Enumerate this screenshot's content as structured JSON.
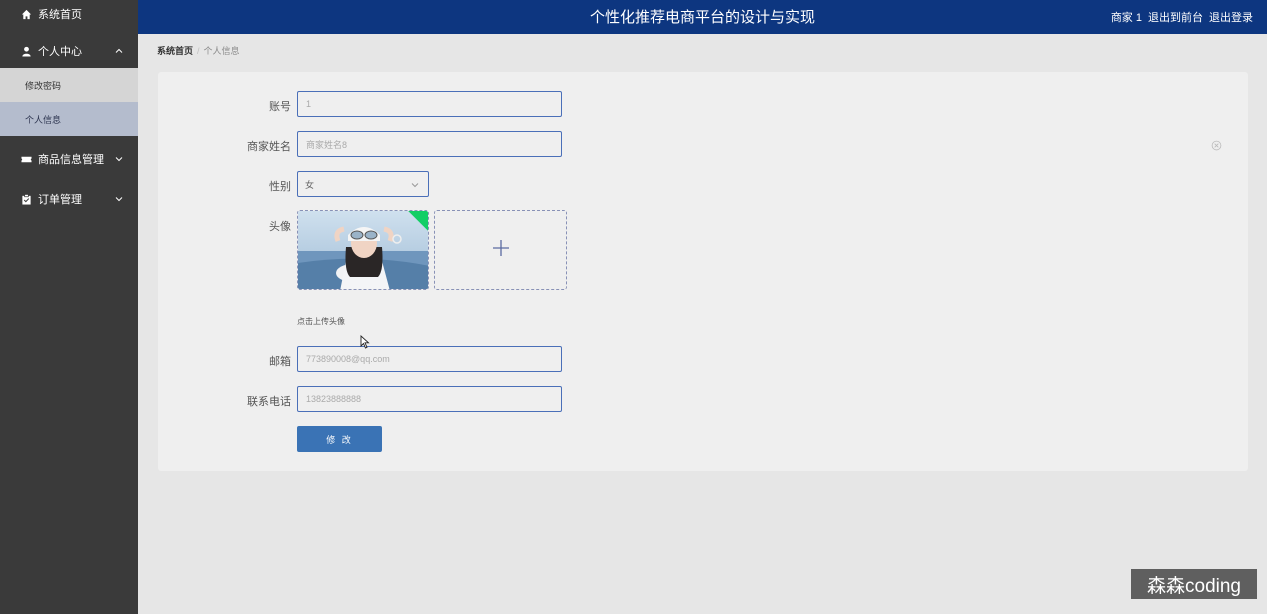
{
  "app": {
    "title": "个性化推荐电商平台的设计与实现"
  },
  "header": {
    "user": "商家 1",
    "exit_front": "退出到前台",
    "logout": "退出登录"
  },
  "sidebar": {
    "home": "系统首页",
    "personal_center": "个人中心",
    "change_password": "修改密码",
    "personal_info": "个人信息",
    "goods_management": "商品信息管理",
    "order_management": "订单管理"
  },
  "breadcrumb": {
    "home": "系统首页",
    "separator": "/",
    "current": "个人信息"
  },
  "form": {
    "account_label": "账号",
    "account_value": "1",
    "name_label": "商家姓名",
    "name_value": "商家姓名8",
    "gender_label": "性别",
    "gender_value": "女",
    "avatar_label": "头像",
    "avatar_hint": "点击上传头像",
    "email_label": "邮箱",
    "email_value": "773890008@qq.com",
    "phone_label": "联系电话",
    "phone_value": "13823888888",
    "submit": "修 改"
  },
  "watermark": "森森coding",
  "colors": {
    "header_bg": "#0d3680",
    "sidebar_bg": "#3a3a3a",
    "active_bg": "#b4bccd",
    "button_bg": "#3a73b5",
    "success_corner": "#13ce66"
  },
  "icons": {
    "home": "home-icon",
    "user": "user-icon",
    "goods": "ticket-icon",
    "order": "clipboard-icon",
    "chevron": "chevron-icon",
    "clear": "clear-icon",
    "plus": "plus-icon",
    "cursor": "cursor-icon"
  }
}
